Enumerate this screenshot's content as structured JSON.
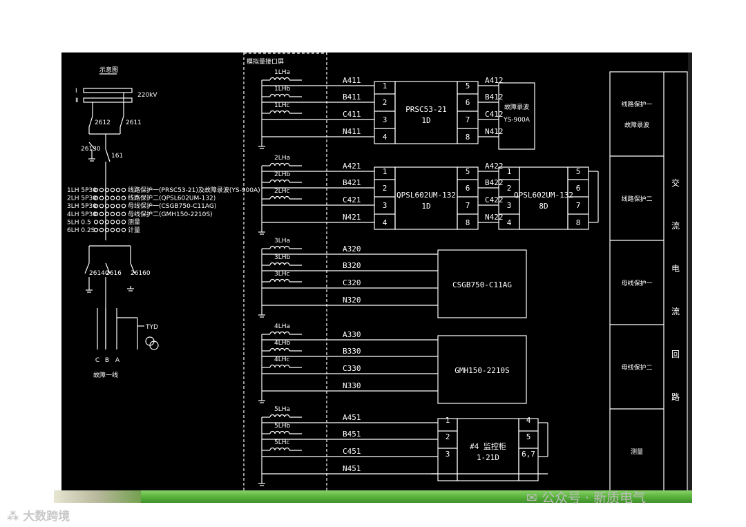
{
  "schematic": {
    "title": "示意图",
    "bus_voltage": "220kV",
    "bus_labels": [
      "Ⅰ",
      "Ⅱ"
    ],
    "switch_labels": [
      "2612",
      "2611",
      "26130",
      "161",
      "26140",
      "2616",
      "26160"
    ],
    "ct_rows": [
      {
        "name": "1LH 5P30",
        "desc": "线路保护一(PRSC53-21)及故障录波(YS-900A)"
      },
      {
        "name": "2LH 5P30",
        "desc": "线路保护二(QPSL602UM-132)"
      },
      {
        "name": "3LH 5P30",
        "desc": "母线保护一(CSGB750-C11AG)"
      },
      {
        "name": "4LH 5P30",
        "desc": "母线保护二(GMH150-2210S)"
      },
      {
        "name": "5LH 0.5",
        "desc": "测量"
      },
      {
        "name": "6LH 0.2S",
        "desc": "计量"
      }
    ],
    "pt_label": "TYD",
    "phase_labels": [
      "C",
      "B",
      "A"
    ],
    "line_label": "故障一线"
  },
  "interface_header": "模拟量接口屏",
  "groups": [
    {
      "cts": [
        "1LHa",
        "1LHb",
        "1LHc"
      ],
      "wires": [
        "A411",
        "B411",
        "C411",
        "N411"
      ],
      "device": {
        "name": "PRSC53-21",
        "sub": "1D",
        "in": [
          "1",
          "2",
          "3",
          "4"
        ],
        "out": [
          "5",
          "6",
          "7",
          "8"
        ]
      },
      "out_wires": [
        "A412",
        "B412",
        "C412",
        "N412"
      ],
      "device2": {
        "name": "故障录波",
        "sub": "YS-900A"
      }
    },
    {
      "cts": [
        "2LHa",
        "2LHb",
        "2LHc"
      ],
      "wires": [
        "A421",
        "B421",
        "C421",
        "N421"
      ],
      "device": {
        "name": "QPSL602UM-132",
        "sub": "1D",
        "in": [
          "1",
          "2",
          "3",
          "4"
        ],
        "out": [
          "5",
          "6",
          "7",
          "8"
        ]
      },
      "out_wires": [
        "A422",
        "B422",
        "C422",
        "N422"
      ],
      "device2": {
        "name": "QPSL602UM-132",
        "sub": "8D",
        "in": [
          "1",
          "2",
          "3",
          "4"
        ],
        "out": [
          "5",
          "6",
          "7",
          "8"
        ]
      }
    },
    {
      "cts": [
        "3LHa",
        "3LHb",
        "3LHc"
      ],
      "wires": [
        "A320",
        "B320",
        "C320",
        "N320"
      ],
      "device": {
        "name": "CSGB750-C11AG"
      }
    },
    {
      "cts": [
        "4LHa",
        "4LHb",
        "4LHc"
      ],
      "wires": [
        "A330",
        "B330",
        "C330",
        "N330"
      ],
      "device": {
        "name": "GMH150-2210S"
      }
    },
    {
      "cts": [
        "5LHa",
        "5LHb",
        "5LHc"
      ],
      "wires": [
        "A451",
        "B451",
        "C451",
        "N451"
      ],
      "device": {
        "name": "#4 监控柜",
        "sub": "1-21D",
        "in": [
          "1",
          "2",
          "3"
        ],
        "out": [
          "4",
          "5",
          "6,7"
        ]
      }
    }
  ],
  "right_panel": {
    "rows": [
      "线路保护一\n故障录波",
      "线路保护二",
      "母线保护一",
      "母线保护二",
      "测量"
    ],
    "vertical_title": [
      "交",
      "流",
      "电",
      "流",
      "回",
      "路"
    ]
  },
  "watermarks": {
    "left": "大数跨境",
    "right": "公众号 · 新质电气"
  }
}
